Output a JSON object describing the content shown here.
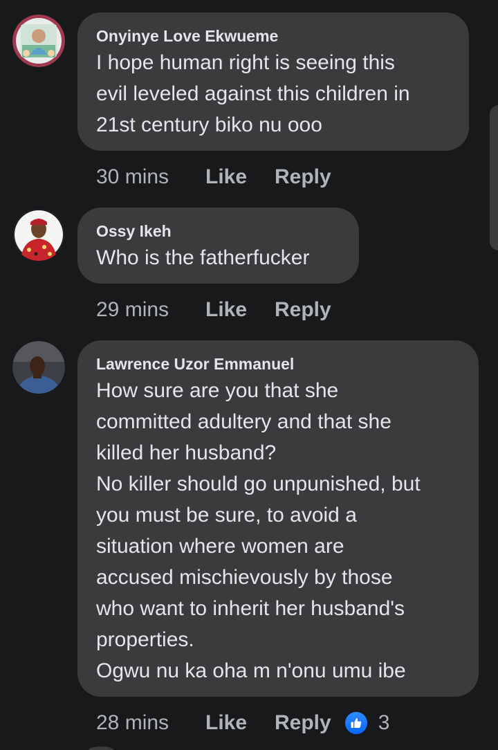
{
  "comments": [
    {
      "author": "Onyinye Love Ekwueme",
      "text": "I hope human right is seeing this\nevil leveled against this children in\n21st century biko nu ooo",
      "time": "30 mins",
      "like_label": "Like",
      "reply_label": "Reply",
      "avatar": "child-photo-avatar"
    },
    {
      "author": "Ossy Ikeh",
      "text": "Who is the fatherfucker",
      "time": "29 mins",
      "like_label": "Like",
      "reply_label": "Reply",
      "avatar": "man-red-attire-avatar"
    },
    {
      "author": "Lawrence Uzor Emmanuel",
      "text": "How sure are you that she\ncommitted adultery and that she\nkilled her husband?\nNo killer should go unpunished, but\nyou must be sure, to avoid a\nsituation where women are\naccused mischievously by those\nwho want to inherit her husband's\nproperties.\nOgwu nu ka oha m n'onu umu ibe",
      "time": "28 mins",
      "like_label": "Like",
      "reply_label": "Reply",
      "reaction_count": "3",
      "reaction_icon": "thumbs-up-icon",
      "avatar": "man-blue-shirt-avatar"
    }
  ],
  "colors": {
    "background": "#18191a",
    "bubble": "#3a3b3c",
    "text": "#e4e6eb",
    "meta": "#b0b3b8",
    "like_blue": "#0866ff"
  }
}
